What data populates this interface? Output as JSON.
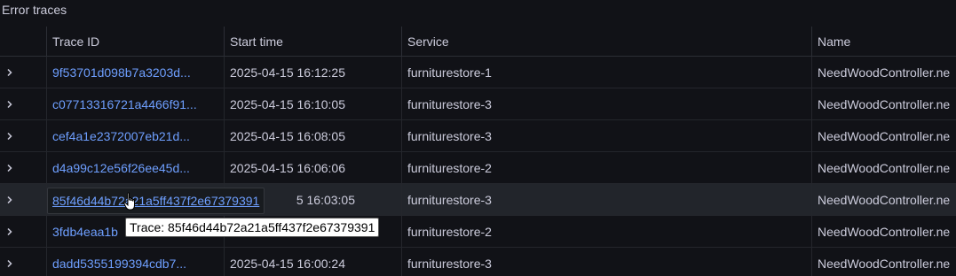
{
  "panel": {
    "title": "Error traces"
  },
  "columns": {
    "trace_id": "Trace ID",
    "start_time": "Start time",
    "service": "Service",
    "name": "Name"
  },
  "rows": [
    {
      "trace_id": "9f53701d098b7a3203d...",
      "start_time": "2025-04-15 16:12:25",
      "service": "furniturestore-1",
      "name": "NeedWoodController.ne"
    },
    {
      "trace_id": "c07713316721a4466f91...",
      "start_time": "2025-04-15 16:10:05",
      "service": "furniturestore-3",
      "name": "NeedWoodController.ne"
    },
    {
      "trace_id": "cef4a1e2372007eb21d...",
      "start_time": "2025-04-15 16:08:05",
      "service": "furniturestore-3",
      "name": "NeedWoodController.ne"
    },
    {
      "trace_id": "d4a99c12e56f26ee45d...",
      "start_time": "2025-04-15 16:06:06",
      "service": "furniturestore-2",
      "name": "NeedWoodController.ne"
    },
    {
      "trace_id": "85f46d44b72a21a5ff437f2e67379391",
      "start_time": "2025-04-15 16:03:05",
      "start_time_visible": "5 16:03:05",
      "service": "furniturestore-3",
      "name": "NeedWoodController.ne"
    },
    {
      "trace_id": "3fdb4eaa1b",
      "start_time": "",
      "service": "furniturestore-2",
      "name": "NeedWoodController.ne"
    },
    {
      "trace_id": "dadd5355199394cdb7...",
      "start_time": "2025-04-15 16:00:24",
      "service": "furniturestore-3",
      "name": "NeedWoodController.ne"
    }
  ],
  "tooltip": {
    "text": "Trace: 85f46d44b72a21a5ff437f2e67379391"
  },
  "colors": {
    "link": "#6e9fff",
    "background": "#111217",
    "row_hover": "#22252b"
  }
}
